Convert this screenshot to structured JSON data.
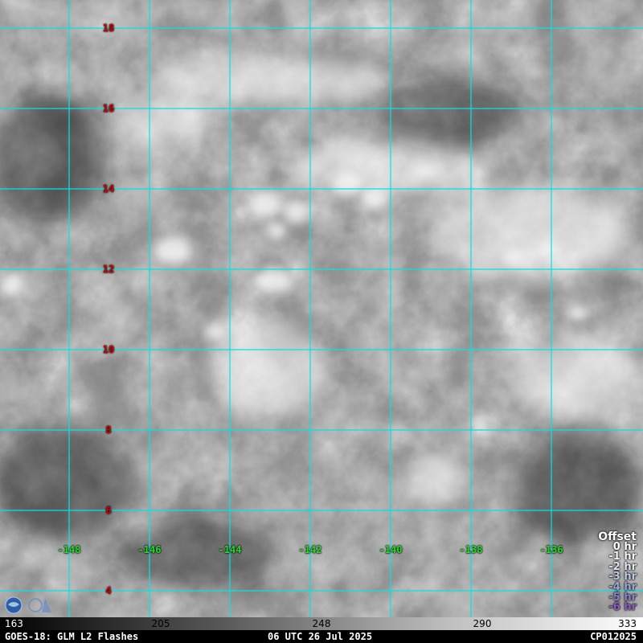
{
  "map": {
    "lat_labels": [
      "18",
      "16",
      "14",
      "12",
      "10",
      "8",
      "6",
      "4"
    ],
    "lon_labels": [
      "-148",
      "-146",
      "-144",
      "-142",
      "-140",
      "-138",
      "-136"
    ],
    "grid_color": "#00e5e5",
    "lat_label_color": "#d40000",
    "lon_label_color": "#22dd22"
  },
  "legend": {
    "title": "Offset",
    "items": [
      {
        "label": "0 hr",
        "color": "#ffffff"
      },
      {
        "label": "-1 hr",
        "color": "#f2f2f2"
      },
      {
        "label": "-2 hr",
        "color": "#dfe4f0"
      },
      {
        "label": "-3 hr",
        "color": "#bcc8e4"
      },
      {
        "label": "-4 hr",
        "color": "#9aa6d6"
      },
      {
        "label": "-5 hr",
        "color": "#8c7fcc"
      },
      {
        "label": "-6 hr",
        "color": "#8a5cc0"
      }
    ]
  },
  "colorbar": {
    "ticks": [
      "163",
      "205",
      "248",
      "290",
      "333"
    ]
  },
  "footer": {
    "left": "GOES-18: GLM L2 Flashes",
    "center": "06 UTC 26 Jul 2025",
    "right": "CP012025"
  }
}
